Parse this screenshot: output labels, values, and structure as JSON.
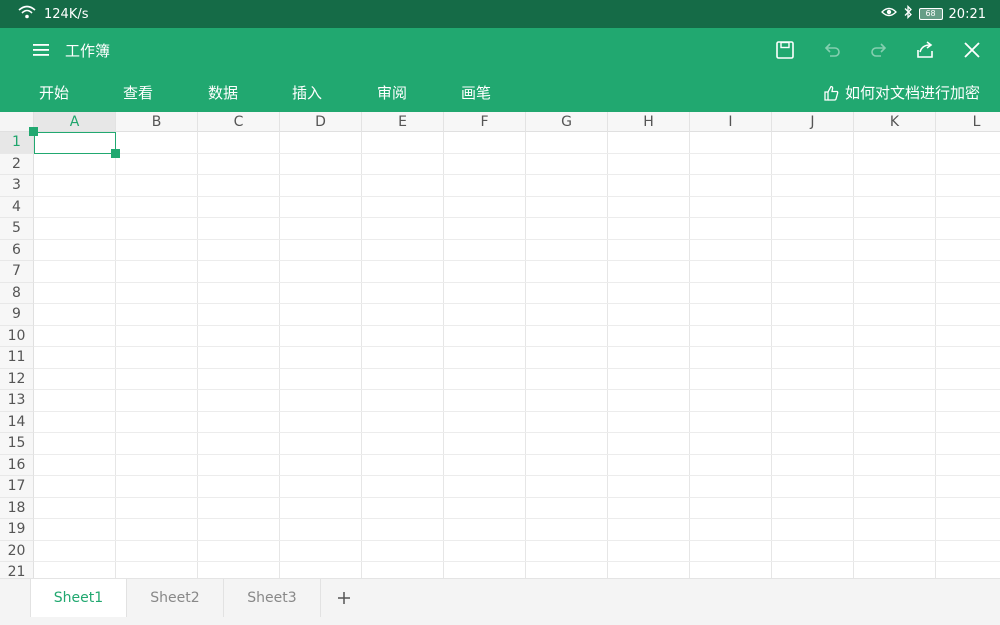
{
  "status_bar": {
    "speed": "124K/s",
    "battery": "68",
    "time": "20:21"
  },
  "app": {
    "title": "工作簿",
    "tabs": [
      "开始",
      "查看",
      "数据",
      "插入",
      "审阅",
      "画笔"
    ],
    "encrypt_hint": "如何对文档进行加密",
    "accent_color": "#21a870",
    "status_color": "#156b47"
  },
  "toolbar_icons": [
    "save-icon",
    "undo-icon",
    "redo-icon",
    "share-icon",
    "close-icon"
  ],
  "grid": {
    "columns": [
      "A",
      "B",
      "C",
      "D",
      "E",
      "F",
      "G",
      "H",
      "I",
      "J",
      "K",
      "L"
    ],
    "rows": [
      "1",
      "2",
      "3",
      "4",
      "5",
      "6",
      "7",
      "8",
      "9",
      "10",
      "11",
      "12",
      "13",
      "14",
      "15",
      "16",
      "17",
      "18",
      "19",
      "20",
      "21"
    ],
    "selected_cell": "A1"
  },
  "sheets": {
    "tabs": [
      "Sheet1",
      "Sheet2",
      "Sheet3"
    ],
    "active": "Sheet1",
    "add_label": "+"
  }
}
